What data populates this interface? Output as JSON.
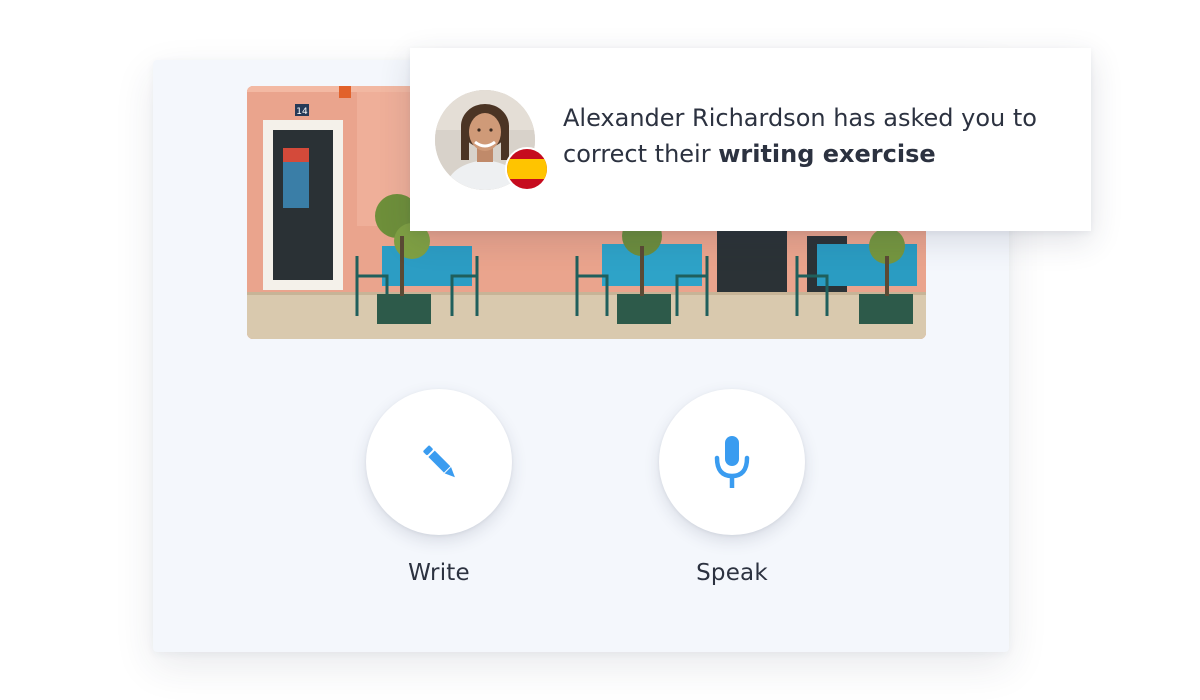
{
  "notification": {
    "user_name": "Alexander Richardson",
    "message_middle": " has asked you to correct their ",
    "highlight": "writing exercise",
    "flag_icon": "spain-flag-icon",
    "flag_colors": {
      "red": "#c60b1e",
      "yellow": "#ffc400"
    }
  },
  "scene": {
    "door_number": "14"
  },
  "actions": {
    "write_label": "Write",
    "write_icon": "pencil-icon",
    "speak_label": "Speak",
    "speak_icon": "microphone-icon",
    "icon_color": "#3a9cf0"
  }
}
